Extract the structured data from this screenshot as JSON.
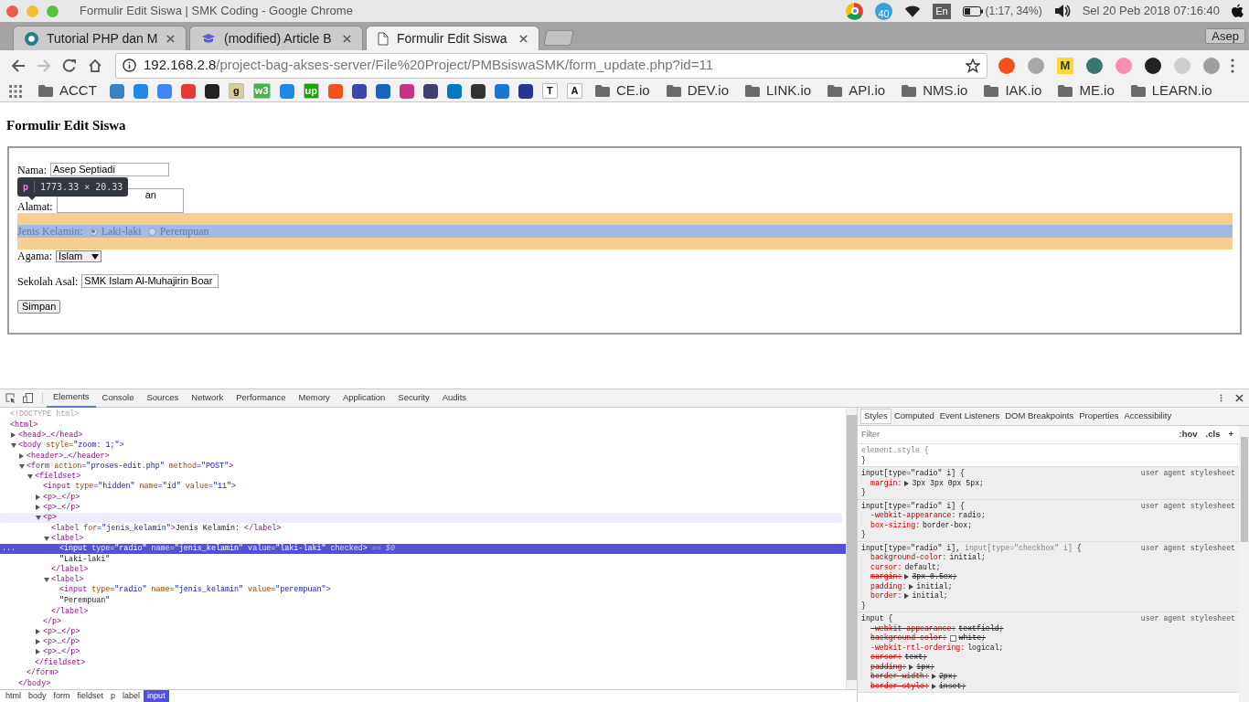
{
  "window": {
    "title": "Formulir Edit Siswa | SMK Coding - Google Chrome"
  },
  "tray": {
    "badge": "40",
    "keyboard": "En",
    "battery": "(1:17, 34%)",
    "clock": "Sel 20 Peb 2018 07:16:40"
  },
  "tabs": [
    {
      "title": "Tutorial PHP dan M",
      "kind": "circle",
      "selected": false
    },
    {
      "title": "(modified) Article B",
      "kind": "book",
      "selected": false
    },
    {
      "title": "Formulir Edit Siswa",
      "kind": "page",
      "selected": true
    }
  ],
  "profile": "Asep",
  "nav_buttons": [
    {
      "kind": "back",
      "disabled": false
    },
    {
      "kind": "forward",
      "disabled": true
    },
    {
      "kind": "reload",
      "disabled": false
    },
    {
      "kind": "home",
      "disabled": false
    }
  ],
  "address": {
    "host": "192.168.2.8",
    "path": "/project-bag-akses-server/File%20Project/PMBsiswaSMK/form_update.php?id=11"
  },
  "extensions": [
    {
      "kind": "app",
      "color": "#f4511e"
    },
    {
      "kind": "app",
      "color": "#a8a8a8"
    },
    {
      "kind": "letter",
      "label": "M",
      "color": "#fdd835"
    },
    {
      "kind": "app",
      "color": "#37796f"
    },
    {
      "kind": "app",
      "color": "#f48fb1"
    },
    {
      "kind": "app",
      "color": "#222222"
    },
    {
      "kind": "app",
      "color": "#cfcfcf"
    },
    {
      "kind": "app",
      "color": "#9e9e9e"
    }
  ],
  "bookmarks": [
    {
      "kind": "folder",
      "label": "ACCT"
    },
    {
      "kind": "app",
      "color": "#3b82c4"
    },
    {
      "kind": "app",
      "color": "#1e88e5"
    },
    {
      "kind": "app",
      "color": "#4285f4"
    },
    {
      "kind": "app",
      "color": "#e53935"
    },
    {
      "kind": "app",
      "color": "#222222"
    },
    {
      "kind": "letter",
      "label": "g",
      "color": "#d9cf96"
    },
    {
      "kind": "letter",
      "label": "w3",
      "color": "#4caf50"
    },
    {
      "kind": "app",
      "color": "#1e88e5"
    },
    {
      "kind": "letter",
      "label": "up",
      "color": "#14a800"
    },
    {
      "kind": "app",
      "color": "#f4511e"
    },
    {
      "kind": "app",
      "color": "#3949ab"
    },
    {
      "kind": "app",
      "color": "#1565c0"
    },
    {
      "kind": "app",
      "color": "#c13584"
    },
    {
      "kind": "app",
      "color": "#3f3f6f"
    },
    {
      "kind": "app",
      "color": "#0079bf"
    },
    {
      "kind": "app",
      "color": "#333333"
    },
    {
      "kind": "app",
      "color": "#1976d2"
    },
    {
      "kind": "app",
      "color": "#283593"
    },
    {
      "kind": "letter",
      "label": "T",
      "color": "#ffffff"
    },
    {
      "kind": "letter",
      "label": "A",
      "color": "#fafafa"
    },
    {
      "kind": "folder",
      "label": "CE.io"
    },
    {
      "kind": "folder",
      "label": "DEV.io"
    },
    {
      "kind": "folder",
      "label": "LINK.io"
    },
    {
      "kind": "folder",
      "label": "API.io"
    },
    {
      "kind": "folder",
      "label": "NMS.io"
    },
    {
      "kind": "folder",
      "label": "IAK.io"
    },
    {
      "kind": "folder",
      "label": "ME.io"
    },
    {
      "kind": "folder",
      "label": "LEARN.io"
    }
  ],
  "page": {
    "heading": "Formulir Edit Siswa",
    "fields": [
      {
        "kind": "text",
        "label": "Nama:",
        "value": "Asep Septiadi",
        "highlighted": false
      },
      {
        "kind": "textarea",
        "label": "Alamat:",
        "value": "an",
        "highlighted": false
      },
      {
        "kind": "radio",
        "label": "Jenis Kelamin:",
        "highlighted": true,
        "options": [
          {
            "label": "Laki-laki",
            "selected": true
          },
          {
            "label": "Perempuan",
            "selected": false
          }
        ]
      },
      {
        "kind": "select",
        "label": "Agama:",
        "value": "Islam",
        "highlighted": false
      },
      {
        "kind": "text",
        "label": "Sekolah Asal:",
        "value": "SMK Islam Al-Muhajirin Boar",
        "highlighted": false
      },
      {
        "kind": "button",
        "label": "Simpan",
        "highlighted": false
      }
    ],
    "tooltip": {
      "tag": "p",
      "size": "1773.33 × 20.33"
    }
  },
  "devtools": {
    "tabs": [
      {
        "label": "Elements",
        "selected": true
      },
      {
        "label": "Console",
        "selected": false
      },
      {
        "label": "Sources",
        "selected": false
      },
      {
        "label": "Network",
        "selected": false
      },
      {
        "label": "Performance",
        "selected": false
      },
      {
        "label": "Memory",
        "selected": false
      },
      {
        "label": "Application",
        "selected": false
      },
      {
        "label": "Security",
        "selected": false
      },
      {
        "label": "Audits",
        "selected": false
      }
    ],
    "tree": [
      {
        "kind": "doctype",
        "text": "<!DOCTYPE html>",
        "selected": false,
        "hovered": false
      },
      {
        "kind": "element",
        "text": "<html>",
        "selected": false,
        "hovered": false,
        "children": [
          {
            "kind": "element",
            "text": "<head>…</head>",
            "expanded": false,
            "selected": false,
            "hovered": false
          },
          {
            "kind": "element",
            "text": "<body style=\"zoom: 1;\">",
            "expanded": true,
            "close": "</body>",
            "selected": false,
            "hovered": false,
            "children": [
              {
                "kind": "element",
                "text": "<header>…</header>",
                "expanded": false,
                "selected": false,
                "hovered": false
              },
              {
                "kind": "element",
                "text": "<form action=\"proses-edit.php\" method=\"POST\">",
                "expanded": true,
                "close": "</form>",
                "selected": false,
                "hovered": false,
                "children": [
                  {
                    "kind": "element",
                    "text": "<fieldset>",
                    "expanded": true,
                    "close": "</fieldset>",
                    "selected": false,
                    "hovered": false,
                    "children": [
                      {
                        "kind": "element",
                        "text": "<input type=\"hidden\" name=\"id\" value=\"11\">",
                        "selected": false,
                        "hovered": false
                      },
                      {
                        "kind": "element",
                        "text": "<p>…</p>",
                        "expanded": false,
                        "selected": false,
                        "hovered": false
                      },
                      {
                        "kind": "element",
                        "text": "<p>…</p>",
                        "expanded": false,
                        "selected": false,
                        "hovered": false
                      },
                      {
                        "kind": "element",
                        "text": "<p>",
                        "expanded": true,
                        "close": "</p>",
                        "selected": false,
                        "hovered": true,
                        "children": [
                          {
                            "kind": "element",
                            "text": "<label for=\"jenis_kelamin\">Jenis Kelamin: </label>",
                            "selected": false,
                            "hovered": false
                          },
                          {
                            "kind": "element",
                            "text": "<label>",
                            "expanded": true,
                            "close": "</label>",
                            "selected": false,
                            "hovered": false,
                            "children": [
                              {
                                "kind": "element",
                                "text": "<input type=\"radio\" name=\"jenis_kelamin\" value=\"laki-laki\" checked>",
                                "suffix": "== $0",
                                "marker": "...",
                                "selected": true,
                                "hovered": false
                              },
                              {
                                "kind": "text",
                                "text": "\"Laki-laki\"",
                                "selected": false,
                                "hovered": false
                              }
                            ]
                          },
                          {
                            "kind": "element",
                            "text": "<label>",
                            "expanded": true,
                            "close": "</label>",
                            "selected": false,
                            "hovered": false,
                            "children": [
                              {
                                "kind": "element",
                                "text": "<input type=\"radio\" name=\"jenis_kelamin\" value=\"perempuan\">",
                                "selected": false,
                                "hovered": false
                              },
                              {
                                "kind": "text",
                                "text": "\"Perempuan\"",
                                "selected": false,
                                "hovered": false
                              }
                            ]
                          }
                        ]
                      },
                      {
                        "kind": "element",
                        "text": "<p>…</p>",
                        "expanded": false,
                        "selected": false,
                        "hovered": false
                      },
                      {
                        "kind": "element",
                        "text": "<p>…</p>",
                        "expanded": false,
                        "selected": false,
                        "hovered": false
                      },
                      {
                        "kind": "element",
                        "text": "<p>…</p>",
                        "expanded": false,
                        "selected": false,
                        "hovered": false
                      }
                    ]
                  }
                ]
              }
            ]
          }
        ]
      }
    ],
    "breadcrumb": [
      {
        "label": "html",
        "selected": false
      },
      {
        "label": "body",
        "selected": false
      },
      {
        "label": "form",
        "selected": false
      },
      {
        "label": "fieldset",
        "selected": false
      },
      {
        "label": "p",
        "selected": false
      },
      {
        "label": "label",
        "selected": false
      },
      {
        "label": "input",
        "selected": true
      }
    ],
    "styles": {
      "tabs": [
        {
          "label": "Styles",
          "selected": true
        },
        {
          "label": "Computed",
          "selected": false
        },
        {
          "label": "Event Listeners",
          "selected": false
        },
        {
          "label": "DOM Breakpoints",
          "selected": false
        },
        {
          "label": "Properties",
          "selected": false
        },
        {
          "label": "Accessibility",
          "selected": false
        }
      ],
      "filter_placeholder": "Filter",
      "tools": [
        ":hov",
        ".cls",
        "+"
      ],
      "rules": [
        {
          "kind": "inline",
          "selector": [
            {
              "text": "element.style {",
              "dim": true
            }
          ],
          "close": "}"
        },
        {
          "kind": "user_agent",
          "origin": "user agent stylesheet",
          "selector": [
            {
              "text": "input[type=\"radio\" i] {",
              "dim": false
            }
          ],
          "close": "}",
          "declarations": [
            {
              "prop": "margin:",
              "value": "3px 3px 0px 5px;",
              "struck": false,
              "expandable": true
            }
          ]
        },
        {
          "kind": "user_agent",
          "origin": "user agent stylesheet",
          "selector": [
            {
              "text": "input[type=\"radio\" i] {",
              "dim": false
            }
          ],
          "close": "}",
          "declarations": [
            {
              "prop": "-webkit-appearance:",
              "value": "radio;",
              "struck": false,
              "expandable": false
            },
            {
              "prop": "box-sizing:",
              "value": "border-box;",
              "struck": false,
              "expandable": false
            }
          ]
        },
        {
          "kind": "user_agent",
          "origin": "user agent stylesheet",
          "selector": [
            {
              "text": "input[type=\"radio\" i],",
              "dim": false
            },
            {
              "text": "input[type=\"checkbox\" i]",
              "dim": true
            },
            {
              "text": "{",
              "dim": false
            }
          ],
          "close": "}",
          "declarations": [
            {
              "prop": "background-color:",
              "value": "initial;",
              "struck": false,
              "expandable": false
            },
            {
              "prop": "cursor:",
              "value": "default;",
              "struck": false,
              "expandable": false
            },
            {
              "prop": "margin:",
              "value": "3px 0.5ex;",
              "struck": true,
              "expandable": true
            },
            {
              "prop": "padding:",
              "value": "initial;",
              "struck": false,
              "expandable": true
            },
            {
              "prop": "border:",
              "value": "initial;",
              "struck": false,
              "expandable": true
            }
          ]
        },
        {
          "kind": "user_agent",
          "origin": "user agent stylesheet",
          "selector": [
            {
              "text": "input {",
              "dim": false
            }
          ],
          "declarations": [
            {
              "prop": "-webkit-appearance:",
              "value": "textfield;",
              "struck": true,
              "expandable": false
            },
            {
              "prop": "background-color:",
              "value": "white;",
              "struck": true,
              "expandable": false,
              "swatch": true
            },
            {
              "prop": "-webkit-rtl-ordering:",
              "value": "logical;",
              "struck": false,
              "expandable": false
            },
            {
              "prop": "cursor:",
              "value": "text;",
              "struck": true,
              "expandable": false
            },
            {
              "prop": "padding:",
              "value": "1px;",
              "struck": true,
              "expandable": true
            },
            {
              "prop": "border-width:",
              "value": "2px;",
              "struck": true,
              "expandable": true
            },
            {
              "prop": "border-style:",
              "value": "inset;",
              "struck": true,
              "expandable": true
            }
          ]
        }
      ]
    }
  }
}
